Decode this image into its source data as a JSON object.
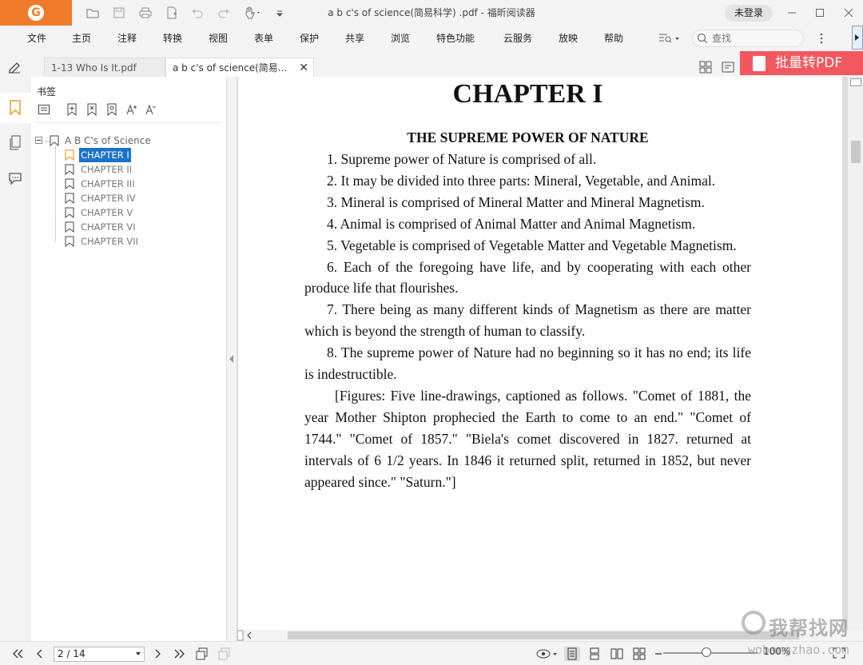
{
  "app": {
    "window_title": "a b c's of science(简易科学) .pdf - 福昕阅读器",
    "login_label": "未登录",
    "batch_convert_label": "批量转PDF"
  },
  "menu": {
    "items": [
      "文件",
      "主页",
      "注释",
      "转换",
      "视图",
      "表单",
      "保护",
      "共享",
      "浏览",
      "特色功能",
      "云服务",
      "放映",
      "帮助"
    ],
    "search_placeholder": "查找"
  },
  "tabs": [
    {
      "label": "1-13 Who Is It.pdf",
      "active": false
    },
    {
      "label": "a b c's of science(简易...",
      "active": true
    }
  ],
  "bookmarks": {
    "panel_title": "书签",
    "root": "A B C's of Science",
    "items": [
      "CHAPTER I",
      "CHAPTER II",
      "CHAPTER III",
      "CHAPTER IV",
      "CHAPTER V",
      "CHAPTER VI",
      "CHAPTER VII"
    ],
    "selected_index": 0
  },
  "document": {
    "chapter_title": "CHAPTER I",
    "section_title": "THE SUPREME POWER OF NATURE",
    "paragraphs": [
      "1. Supreme power of Nature is comprised of all.",
      "2. It may be divided into three parts:  Mineral, Vegetable, and Animal.",
      "3. Mineral is comprised of Mineral Matter and Mineral Magnetism.",
      "4. Animal is comprised of Animal Matter and Animal Magnetism.",
      "5. Vegetable is comprised of Vegetable Matter and Vegetable Magnetism.",
      "6. Each of the foregoing have life, and by cooperating with each other produce life that flourishes.",
      "7. There being as many different kinds of Magnetism as there are matter which is beyond the strength of human to classify.",
      "8. The supreme power of Nature had no beginning so it has no end; its life is indestructible.",
      "[Figures:  Five line-drawings, captioned as follows.  \"Comet of 1881, the year Mother Shipton prophecied the Earth to come to an end.\"  \"Comet of 1744.\"   \"Comet of 1857.\"   \"Biela's comet discovered in 1827. returned at intervals of 6 1/2 years.   In 1846 it returned split, returned in 1852, but never appeared since.\"   \"Saturn.\"]"
    ]
  },
  "status": {
    "page_indicator": "2 / 14",
    "zoom": "100%"
  },
  "watermark": {
    "main": "我帮找网",
    "sub": "wobangzhao.com"
  },
  "colors": {
    "brand_orange": "#f07b2a",
    "batch_red": "#f3575f",
    "selection_blue": "#1a73c8",
    "bookmark_active_orange": "#f0a030"
  }
}
